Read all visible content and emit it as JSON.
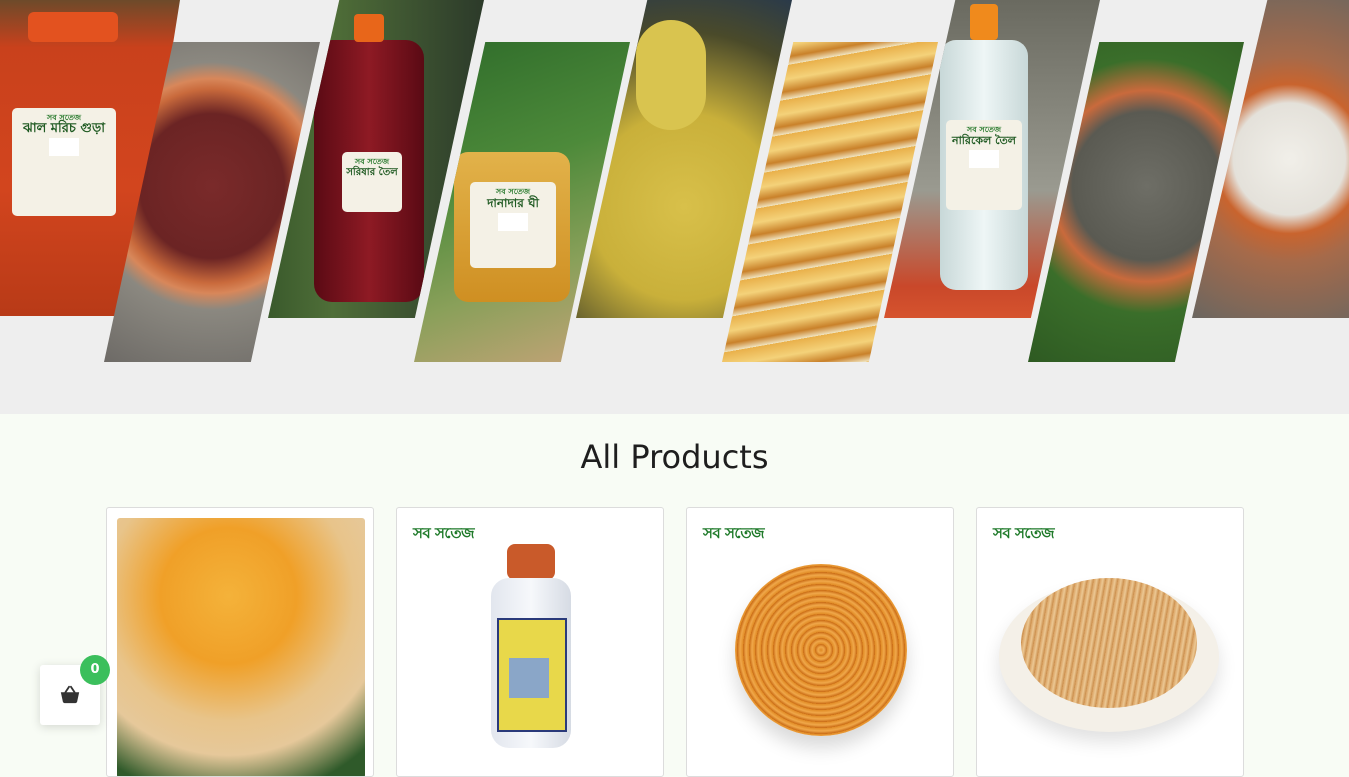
{
  "hero": {
    "slides": [
      {
        "label": "ঝাল মরিচ গুড়া",
        "brand": "সব সতেজ"
      },
      {
        "label": "",
        "brand": ""
      },
      {
        "label": "সরিষার তৈল",
        "brand": "সব সতেজ"
      },
      {
        "label": "দানাদার ঘী",
        "brand": "সব সতেজ"
      },
      {
        "label": "",
        "brand": ""
      },
      {
        "label": "",
        "brand": ""
      },
      {
        "label": "নারিকেল তৈল",
        "brand": "সব সতেজ"
      },
      {
        "label": "",
        "brand": ""
      },
      {
        "label": "",
        "brand": ""
      }
    ]
  },
  "products_section": {
    "title": "All Products"
  },
  "products": [
    {
      "brand": ""
    },
    {
      "brand": "সব সতেজ"
    },
    {
      "brand": "সব সতেজ"
    },
    {
      "brand": "সব সতেজ"
    }
  ],
  "cart": {
    "count": "0",
    "icon": "basket-icon"
  },
  "colors": {
    "hero_bg": "#eeeeee",
    "page_bg": "#f8fcf5",
    "badge": "#3bbf5c",
    "brand_green": "#1f7a2a"
  }
}
